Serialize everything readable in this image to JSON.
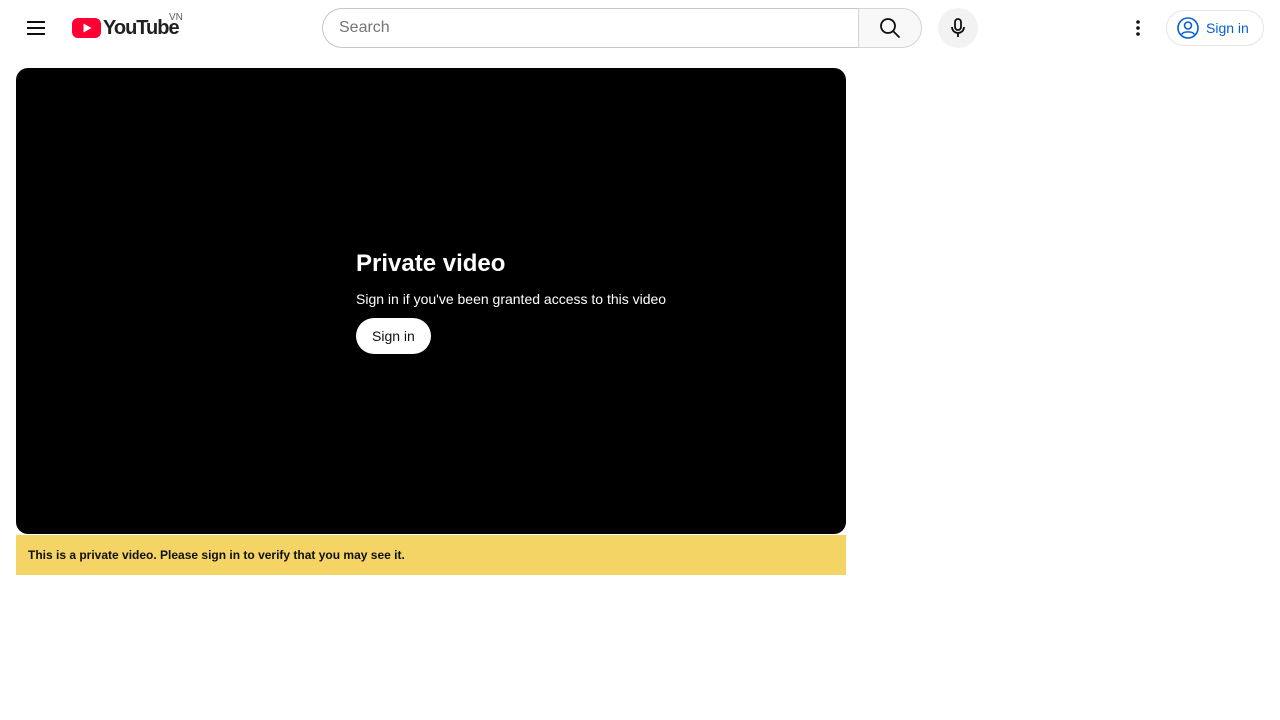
{
  "header": {
    "logo_text": "YouTube",
    "country_code": "VN",
    "search": {
      "placeholder": "Search",
      "value": ""
    },
    "signin_label": "Sign in"
  },
  "icons": {
    "menu": "menu-icon",
    "logo": "youtube-logo-icon",
    "search": "search-icon",
    "mic": "mic-icon",
    "more": "more-vert-icon",
    "account": "account-circle-icon"
  },
  "player": {
    "error_title": "Private video",
    "error_subtitle": "Sign in if you've been granted access to this video",
    "signin_button_label": "Sign in"
  },
  "banner": {
    "message": "This is a private video. Please sign in to verify that you may see it."
  },
  "colors": {
    "brand_red": "#ff0033",
    "link_blue": "#065fd4",
    "banner_yellow": "#f4d465",
    "player_bg": "#000000"
  }
}
